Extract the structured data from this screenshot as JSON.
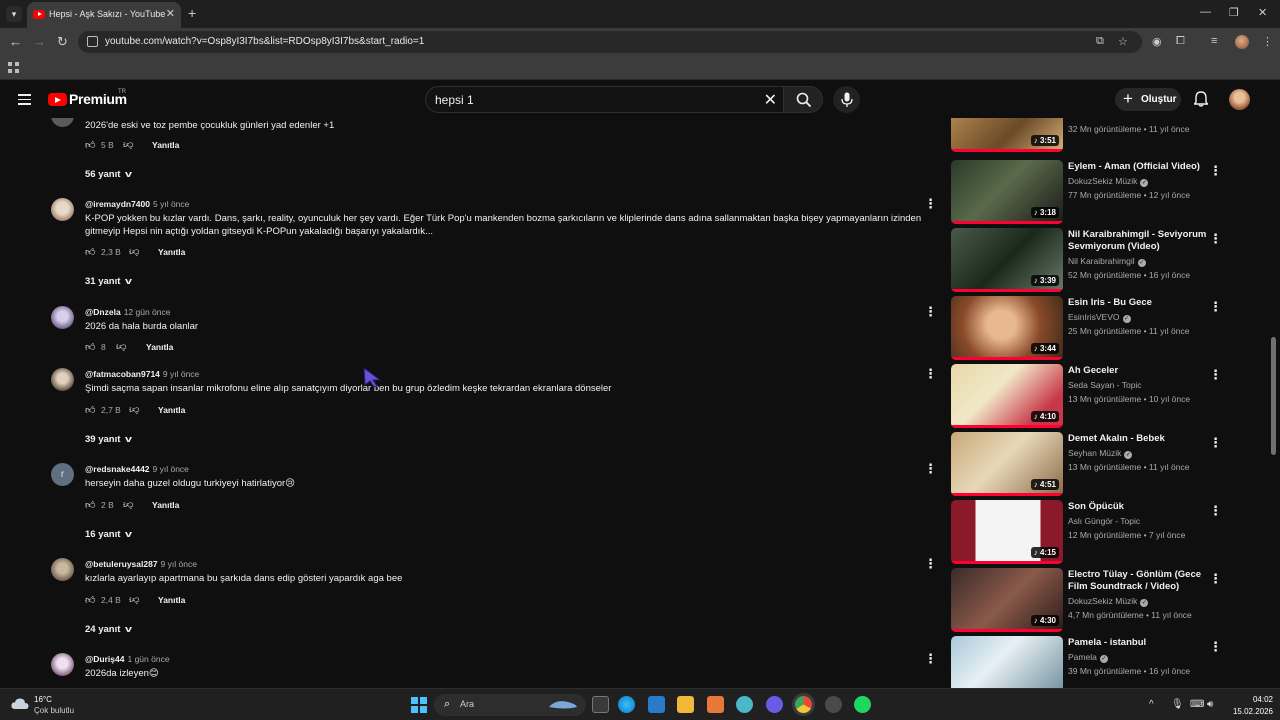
{
  "browser": {
    "tab_title": "Hepsi - Aşk Sakızı - YouTube",
    "url": "youtube.com/watch?v=Osp8yI3I7bs&list=RDOsp8yI3I7bs&start_radio=1"
  },
  "header": {
    "brand": "Premium",
    "country": "TR",
    "search_query": "hepsi 1",
    "create_label": "Oluştur"
  },
  "comments": [
    {
      "author": "",
      "time": "",
      "text": "2026'de eski ve toz pembe çocukluk günleri yad edenler +1",
      "likes": "5 B",
      "reply": "Yanıtla",
      "replies": "56 yanıt"
    },
    {
      "author": "@iremaydn7400",
      "time": "5 yıl önce",
      "text": "K-POP yokken bu kızlar vardı. Dans, şarkı, reality, oyunculuk her şey vardı. Eğer Türk Pop'u mankenden bozma şarkıcıların ve kliplerinde dans adına sallanmaktan başka bişey yapmayanların izinden gitmeyip Hepsi nin açtığı yoldan gitseydi K-POPun yakaladığı başarıyı yakalardık...",
      "likes": "2,3 B",
      "reply": "Yanıtla",
      "replies": "31 yanıt"
    },
    {
      "author": "@Dnzela",
      "time": "12 gün önce",
      "text": "2026 da hala burda olanlar",
      "likes": "8",
      "reply": "Yanıtla",
      "replies": ""
    },
    {
      "author": "@fatmacoban9714",
      "time": "9 yıl önce",
      "text": "Şimdi saçma sapan insanlar mikrofonu eline alıp sanatçıyım diyorlar ben bu  grup özledim keşke tekrardan ekranlara dönseler",
      "likes": "2,7 B",
      "reply": "Yanıtla",
      "replies": "39 yanıt"
    },
    {
      "author": "@redsnake4442",
      "time": "9 yıl önce",
      "text": "herseyin daha guzel oldugu turkiyeyi hatirlatiyor😢",
      "likes": "2 B",
      "reply": "Yanıtla",
      "replies": "16 yanıt",
      "avatar_letter": "r"
    },
    {
      "author": "@betuleruysal287",
      "time": "9 yıl önce",
      "text": "kızlarla ayarlayıp apartmana bu şarkıda dans edip gösteri yapardık aga bee",
      "likes": "2,4 B",
      "reply": "Yanıtla",
      "replies": "24 yanıt"
    },
    {
      "author": "@Duriş44",
      "time": "1 gün önce",
      "text": "2026da izleyen😊",
      "likes": "",
      "reply": "",
      "replies": ""
    }
  ],
  "videos": [
    {
      "title": "",
      "channel": "",
      "stats": "32 Mn görüntüleme • 11 yıl önce",
      "duration": "3:51",
      "verified": false
    },
    {
      "title": "Eylem - Aman (Official Video)",
      "channel": "DokuzSekiz Müzik",
      "stats": "77 Mn görüntüleme • 12 yıl önce",
      "duration": "3:18",
      "verified": true
    },
    {
      "title": "Nil Karaibrahimgil - Seviyorum Sevmiyorum (Video)",
      "channel": "Nil Karaibrahimgil",
      "stats": "52 Mn görüntüleme • 16 yıl önce",
      "duration": "3:39",
      "verified": true
    },
    {
      "title": "Esin Iris - Bu Gece",
      "channel": "EsinIrisVEVO",
      "stats": "25 Mn görüntüleme • 11 yıl önce",
      "duration": "3:44",
      "verified": true
    },
    {
      "title": "Ah Geceler",
      "channel": "Seda Sayan - Topic",
      "stats": "13 Mn görüntüleme • 10 yıl önce",
      "duration": "4:10",
      "verified": false
    },
    {
      "title": "Demet Akalın - Bebek",
      "channel": "Seyhan Müzik",
      "stats": "13 Mn görüntüleme • 11 yıl önce",
      "duration": "4:51",
      "verified": true
    },
    {
      "title": "Son Öpücük",
      "channel": "Aslı Güngör - Topic",
      "stats": "12 Mn görüntüleme • 7 yıl önce",
      "duration": "4:15",
      "verified": false
    },
    {
      "title": "Electro Tülay - Gönlüm (Gece Film Soundtrack / Video)",
      "channel": "DokuzSekiz Müzik",
      "stats": "4,7 Mn görüntüleme • 11 yıl önce",
      "duration": "4:30",
      "verified": true
    },
    {
      "title": "Pamela - istanbul",
      "channel": "Pamela",
      "stats": "39 Mn görüntüleme • 16 yıl önce",
      "duration": "",
      "verified": true
    }
  ],
  "taskbar": {
    "temperature": "16°C",
    "weather": "Çok bulutlu",
    "search_placeholder": "Ara",
    "time": "04:02",
    "date": "15.02.2026"
  },
  "colors": {
    "background": "#0f0f0f",
    "accent": "#ff0000",
    "progress": "#ff0033"
  },
  "icons": [
    "menu-icon",
    "youtube-logo-icon",
    "search-icon",
    "mic-icon",
    "bell-icon",
    "thumb-up-icon",
    "thumb-down-icon",
    "more-vert-icon",
    "chevron-down-icon",
    "verified-icon",
    "music-note-icon"
  ]
}
